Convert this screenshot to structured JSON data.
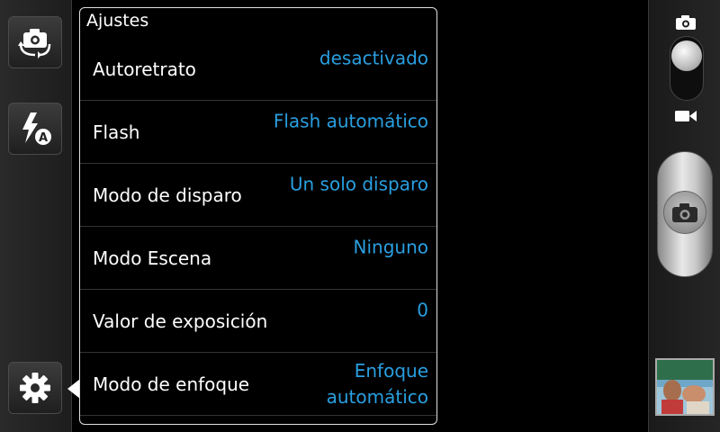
{
  "panel": {
    "title": "Ajustes",
    "rows": [
      {
        "label": "Autoretrato",
        "value": "desactivado"
      },
      {
        "label": "Flash",
        "value": "Flash automático"
      },
      {
        "label": "Modo de disparo",
        "value": "Un solo disparo"
      },
      {
        "label": "Modo Escena",
        "value": "Ninguno"
      },
      {
        "label": "Valor de exposición",
        "value": "0"
      },
      {
        "label": "Modo de enfoque",
        "value_line1": "Enfoque",
        "value_line2": "automático"
      }
    ]
  },
  "sidebar": {
    "buttons": [
      {
        "icon": "switch-camera-icon"
      },
      {
        "icon": "flash-auto-icon"
      },
      {
        "icon": "gear-icon"
      }
    ]
  },
  "right_bar": {
    "mode_icons": [
      "camera-mode-icon",
      "video-mode-icon"
    ],
    "selected_mode": "camera",
    "shutter_icon": "camera-icon"
  },
  "colors": {
    "accent": "#2a9fe0",
    "background": "#000000"
  }
}
